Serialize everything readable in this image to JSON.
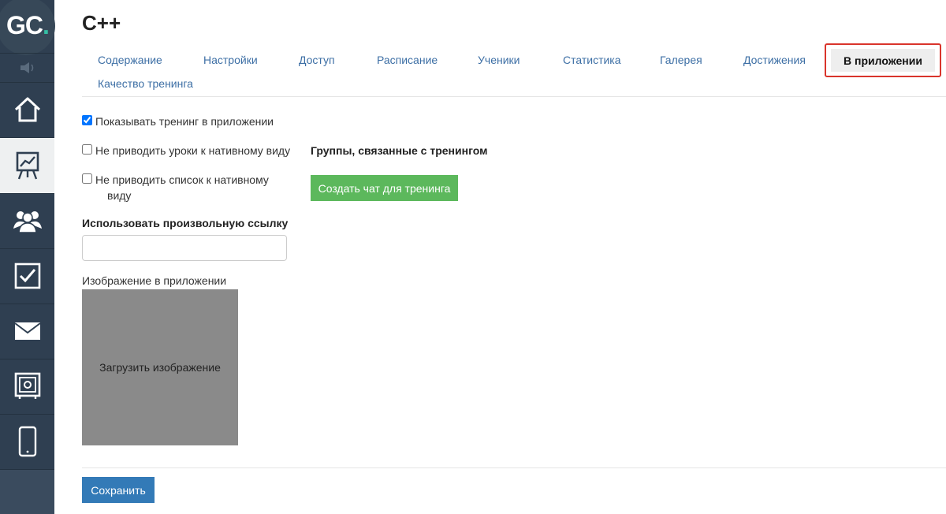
{
  "logo": {
    "letters": "GC",
    "dot": "."
  },
  "sidebar": {
    "items": [
      {
        "id": "home",
        "icon": "home-icon"
      },
      {
        "id": "trainings",
        "icon": "presentation-chart-icon",
        "active": true
      },
      {
        "id": "users",
        "icon": "users-icon"
      },
      {
        "id": "tasks",
        "icon": "checkbox-icon"
      },
      {
        "id": "messages",
        "icon": "envelope-icon"
      },
      {
        "id": "safe",
        "icon": "safe-icon"
      },
      {
        "id": "mobile",
        "icon": "mobile-icon"
      }
    ]
  },
  "page": {
    "title": "C++"
  },
  "tabs": [
    "Содержание",
    "Настройки",
    "Доступ",
    "Расписание",
    "Ученики",
    "Статистика",
    "Галерея",
    "Достижения",
    "Качество тренинга"
  ],
  "active_tab": "В приложении",
  "form": {
    "show_in_app": "Показывать тренинг в приложении",
    "no_native_lessons": "Не приводить уроки к нативному виду",
    "no_native_list_1": "Не приводить список к нативному",
    "no_native_list_2": "виду",
    "custom_link_label": "Использовать произвольную ссылку",
    "custom_link_value": "",
    "image_label": "Изображение в приложении",
    "upload_label": "Загрузить изображение",
    "groups_label": "Группы, связанные с тренингом",
    "create_chat_label": "Создать чат для тренинга",
    "save_label": "Сохранить"
  },
  "colors": {
    "sidebar": "#2f3f51",
    "accent_link": "#3d6fa5",
    "highlight_border": "#d9342b",
    "green_button": "#5cb85c",
    "blue_button": "#337ab7"
  }
}
